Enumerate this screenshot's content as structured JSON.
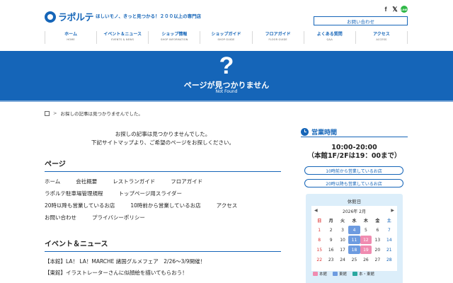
{
  "header": {
    "logo_text": "ラポルテ",
    "tagline": "ほしいモノ、きっと見つかる！２００以上の専門店",
    "contact_button": "お問い合わせ",
    "sns": {
      "facebook": "f",
      "x": "𝕏",
      "line": "LINE"
    },
    "nav": [
      {
        "ja": "ホーム",
        "en": "HOME"
      },
      {
        "ja": "イベント＆ニュース",
        "en": "EVENTS & NEWS"
      },
      {
        "ja": "ショップ情報",
        "en": "SHOP INFORMATION"
      },
      {
        "ja": "ショップガイド",
        "en": "SHOP GUIDE"
      },
      {
        "ja": "フロアガイド",
        "en": "FLOOR GUIDE"
      },
      {
        "ja": "よくある質問",
        "en": "Q&A"
      },
      {
        "ja": "アクセス",
        "en": "ACCESS"
      }
    ]
  },
  "hero": {
    "symbol": "?",
    "title": "ページが見つかりません",
    "subtitle": "Not Found"
  },
  "breadcrumb": {
    "separator": ">",
    "current": "お探しの記事は見つかりませんでした。"
  },
  "main": {
    "message_line1": "お探しの記事は見つかりませんでした。",
    "message_line2": "下記サイトマップより、ご希望のページをお探しください。",
    "pages_title": "ページ",
    "pages": [
      [
        "ホーム",
        "会社概要",
        "レストランガイド",
        "フロアガイド"
      ],
      [
        "ラポルテ駐車場管理規程",
        "トップページ用スライダー"
      ],
      [
        "20時以降も営業しているお店",
        "10時前から営業しているお店",
        "アクセス"
      ],
      [
        "お問い合わせ",
        "プライバシーポリシー"
      ]
    ],
    "news_title": "イベント＆ニュース",
    "news": [
      "【本館】LA！ LA！MARCHE 諸国グルメフェア　2/26〜3/9開催！",
      "【東館】イラストレーターさんに似顔絵を描いてもらおう！"
    ]
  },
  "sidebar": {
    "title": "営業時間",
    "hours": "10:00-20:00",
    "hours_note": "（本館1F/2Fは19：00まで）",
    "before10_button": "10時前から営業しているお店",
    "after20_button": "20時以降も営業しているお店",
    "calendar": {
      "heading": "休館日",
      "month": "2026年 2月",
      "prev": "◀",
      "next": "▶",
      "weekdays": [
        "日",
        "月",
        "火",
        "水",
        "木",
        "金",
        "土"
      ],
      "days": [
        1,
        2,
        3,
        4,
        5,
        6,
        7,
        8,
        9,
        10,
        11,
        12,
        13,
        14,
        15,
        16,
        17,
        18,
        19,
        20,
        21,
        22,
        23,
        24,
        25,
        26,
        27,
        28
      ],
      "closed_honkan": [
        12,
        19
      ],
      "closed_higashi": [
        4,
        11,
        18
      ],
      "legend": [
        "本館",
        "東館",
        "本・東館"
      ],
      "colors": {
        "honkan": "#f08bb0",
        "higashi": "#6d9be0",
        "both": "#2aa8a0",
        "sunday": "#d33",
        "saturday": "#1565b8"
      }
    }
  },
  "colors": {
    "brand": "#1565b8"
  }
}
